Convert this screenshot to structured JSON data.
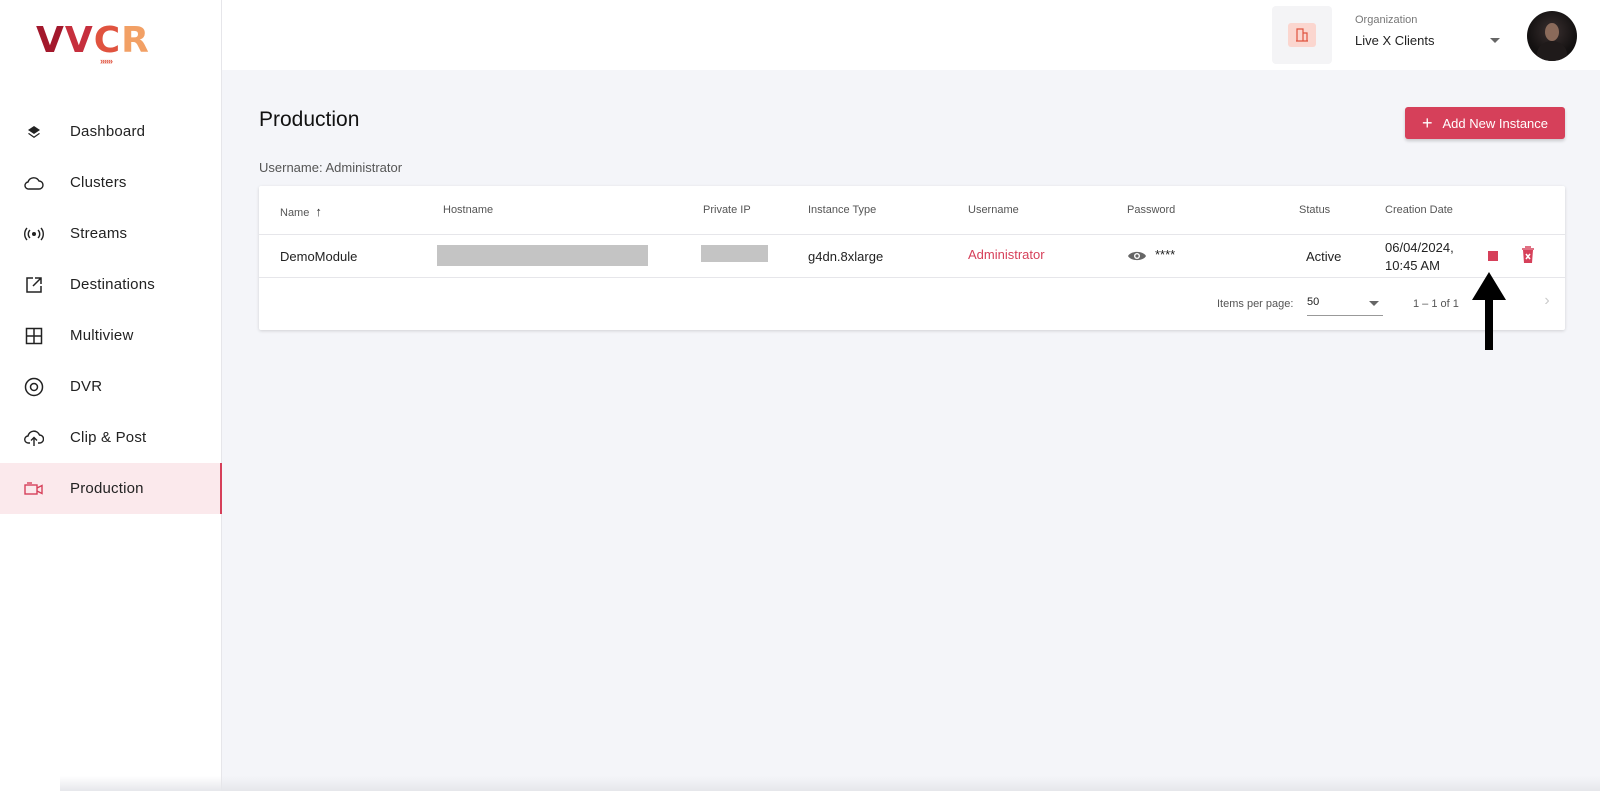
{
  "app": {
    "logo_text": "VVCR",
    "brand_color": "#d6405a"
  },
  "sidebar": {
    "items": [
      {
        "label": "Dashboard",
        "icon": "layers-icon"
      },
      {
        "label": "Clusters",
        "icon": "cloud-icon"
      },
      {
        "label": "Streams",
        "icon": "broadcast-icon"
      },
      {
        "label": "Destinations",
        "icon": "external-link-icon"
      },
      {
        "label": "Multiview",
        "icon": "grid-icon"
      },
      {
        "label": "DVR",
        "icon": "disc-icon"
      },
      {
        "label": "Clip & Post",
        "icon": "cloud-upload-icon"
      },
      {
        "label": "Production",
        "icon": "camera-icon",
        "active": true
      }
    ]
  },
  "header": {
    "org_label": "Organization",
    "org_value": "Live X Clients"
  },
  "main": {
    "title": "Production",
    "add_button_label": "Add New Instance",
    "username_line": "Username: Administrator",
    "table": {
      "columns": [
        "Name",
        "Hostname",
        "Private IP",
        "Instance Type",
        "Username",
        "Password",
        "Status",
        "Creation Date"
      ],
      "rows": [
        {
          "name": "DemoModule",
          "hostname": "",
          "private_ip": "",
          "instance_type": "g4dn.8xlarge",
          "username": "Administrator",
          "password": "****",
          "status": "Active",
          "creation_date_line1": "06/04/2024,",
          "creation_date_line2": "10:45 AM"
        }
      ]
    },
    "paginator": {
      "items_per_page_label": "Items per page:",
      "items_per_page_value": "50",
      "range_label": "1 – 1 of 1"
    }
  }
}
